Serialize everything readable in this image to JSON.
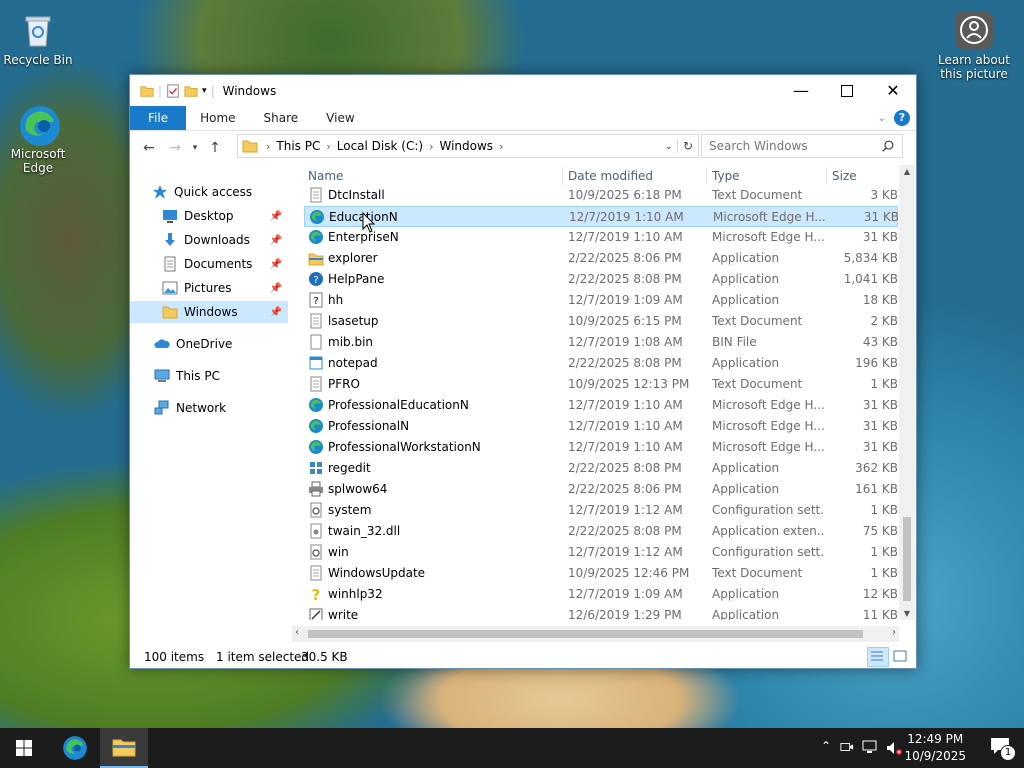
{
  "desktop": {
    "icons": [
      {
        "label": "Recycle Bin"
      },
      {
        "label": "Microsoft Edge"
      },
      {
        "label": "Learn about this picture"
      }
    ]
  },
  "window": {
    "title": "Windows",
    "ribbon_tabs": [
      "File",
      "Home",
      "Share",
      "View"
    ],
    "help": "?",
    "address": {
      "crumbs": [
        "This PC",
        "Local Disk (C:)",
        "Windows"
      ]
    },
    "search_placeholder": "Search Windows",
    "nav": {
      "quick_access": "Quick access",
      "items": [
        {
          "label": "Desktop",
          "icon": "desktop-icon",
          "pinned": true
        },
        {
          "label": "Downloads",
          "icon": "downloads-icon",
          "pinned": true
        },
        {
          "label": "Documents",
          "icon": "documents-icon",
          "pinned": true
        },
        {
          "label": "Pictures",
          "icon": "pictures-icon",
          "pinned": true
        },
        {
          "label": "Windows",
          "icon": "folder-icon",
          "pinned": true,
          "selected": true
        }
      ],
      "onedrive": "OneDrive",
      "thispc": "This PC",
      "network": "Network"
    },
    "columns": [
      "Name",
      "Date modified",
      "Type",
      "Size"
    ],
    "files": [
      {
        "name": "DtcInstall",
        "date": "10/9/2025 6:18 PM",
        "type": "Text Document",
        "size": "3 KB",
        "icon": "text"
      },
      {
        "name": "EducationN",
        "date": "12/7/2019 1:10 AM",
        "type": "Microsoft Edge H...",
        "size": "31 KB",
        "icon": "edge",
        "selected": true
      },
      {
        "name": "EnterpriseN",
        "date": "12/7/2019 1:10 AM",
        "type": "Microsoft Edge H...",
        "size": "31 KB",
        "icon": "edge"
      },
      {
        "name": "explorer",
        "date": "2/22/2025 8:06 PM",
        "type": "Application",
        "size": "5,834 KB",
        "icon": "explorer"
      },
      {
        "name": "HelpPane",
        "date": "2/22/2025 8:08 PM",
        "type": "Application",
        "size": "1,041 KB",
        "icon": "help"
      },
      {
        "name": "hh",
        "date": "12/7/2019 1:09 AM",
        "type": "Application",
        "size": "18 KB",
        "icon": "hh"
      },
      {
        "name": "lsasetup",
        "date": "10/9/2025 6:15 PM",
        "type": "Text Document",
        "size": "2 KB",
        "icon": "text"
      },
      {
        "name": "mib.bin",
        "date": "12/7/2019 1:08 AM",
        "type": "BIN File",
        "size": "43 KB",
        "icon": "file"
      },
      {
        "name": "notepad",
        "date": "2/22/2025 8:08 PM",
        "type": "Application",
        "size": "196 KB",
        "icon": "notepad"
      },
      {
        "name": "PFRO",
        "date": "10/9/2025 12:13 PM",
        "type": "Text Document",
        "size": "1 KB",
        "icon": "text"
      },
      {
        "name": "ProfessionalEducationN",
        "date": "12/7/2019 1:10 AM",
        "type": "Microsoft Edge H...",
        "size": "31 KB",
        "icon": "edge"
      },
      {
        "name": "ProfessionalN",
        "date": "12/7/2019 1:10 AM",
        "type": "Microsoft Edge H...",
        "size": "31 KB",
        "icon": "edge"
      },
      {
        "name": "ProfessionalWorkstationN",
        "date": "12/7/2019 1:10 AM",
        "type": "Microsoft Edge H...",
        "size": "31 KB",
        "icon": "edge"
      },
      {
        "name": "regedit",
        "date": "2/22/2025 8:08 PM",
        "type": "Application",
        "size": "362 KB",
        "icon": "regedit"
      },
      {
        "name": "splwow64",
        "date": "2/22/2025 8:06 PM",
        "type": "Application",
        "size": "161 KB",
        "icon": "printer"
      },
      {
        "name": "system",
        "date": "12/7/2019 1:12 AM",
        "type": "Configuration sett...",
        "size": "1 KB",
        "icon": "config"
      },
      {
        "name": "twain_32.dll",
        "date": "2/22/2025 8:08 PM",
        "type": "Application exten...",
        "size": "75 KB",
        "icon": "dll"
      },
      {
        "name": "win",
        "date": "12/7/2019 1:12 AM",
        "type": "Configuration sett...",
        "size": "1 KB",
        "icon": "config"
      },
      {
        "name": "WindowsUpdate",
        "date": "10/9/2025 12:46 PM",
        "type": "Text Document",
        "size": "1 KB",
        "icon": "text"
      },
      {
        "name": "winhlp32",
        "date": "12/7/2019 1:09 AM",
        "type": "Application",
        "size": "12 KB",
        "icon": "winhlp"
      },
      {
        "name": "write",
        "date": "12/6/2019 1:29 PM",
        "type": "Application",
        "size": "11 KB",
        "icon": "write"
      }
    ],
    "status": {
      "count": "100 items",
      "selected": "1 item selected",
      "size": "30.5 KB"
    }
  },
  "taskbar": {
    "time": "12:49 PM",
    "date": "10/9/2025",
    "notifications": "1"
  },
  "colors": {
    "accent": "#1979ca",
    "selection": "#cce8ff",
    "taskbar": "#1c1c1c"
  }
}
